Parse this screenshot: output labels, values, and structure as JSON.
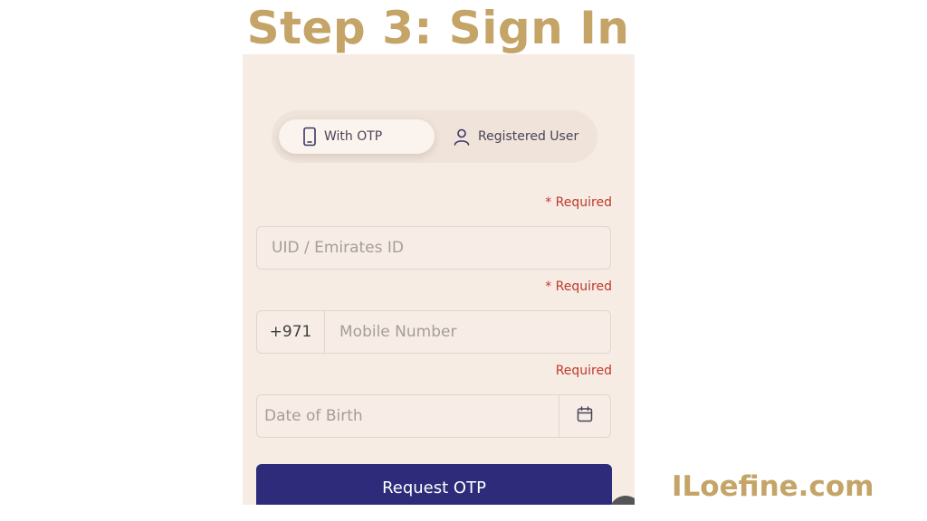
{
  "header": {
    "title": "Step 3: Sign In"
  },
  "watermark": {
    "text": "ILoefine.com"
  },
  "login": {
    "tabs": [
      {
        "label": "With OTP",
        "icon": "phone-icon",
        "selected": true
      },
      {
        "label": "Registered User",
        "icon": "user-icon",
        "selected": false
      }
    ],
    "uid": {
      "required": "* Required",
      "placeholder": "UID / Emirates ID",
      "value": ""
    },
    "mobile": {
      "required": "* Required",
      "prefix": "+971",
      "placeholder": "Mobile Number",
      "value": ""
    },
    "dob": {
      "required": "Required",
      "placeholder": "Date of Birth",
      "value": "",
      "icon": "calendar-icon"
    },
    "submit_label": "Request OTP"
  },
  "colors": {
    "title": "#c5a468",
    "panel_bg": "#f6ece4",
    "required": "#c0392b",
    "button": "#2e2c7a"
  }
}
